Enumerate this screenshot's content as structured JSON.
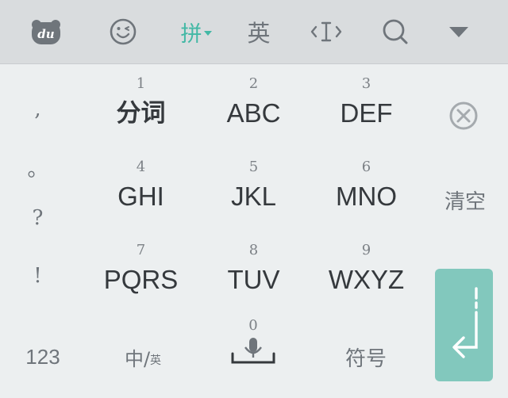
{
  "toolbar": {
    "logo_text": "du",
    "pinyin_label": "拼",
    "english_label": "英",
    "icons": [
      "baidu-logo-icon",
      "emoji-icon",
      "cursor-icon",
      "search-icon",
      "collapse-triangle-icon"
    ]
  },
  "punctuation": [
    ",",
    "。",
    "?",
    "!"
  ],
  "keys": [
    {
      "num": "1",
      "letters": "分词"
    },
    {
      "num": "2",
      "letters": "ABC"
    },
    {
      "num": "3",
      "letters": "DEF"
    },
    {
      "num": "4",
      "letters": "GHI"
    },
    {
      "num": "5",
      "letters": "JKL"
    },
    {
      "num": "6",
      "letters": "MNO"
    },
    {
      "num": "7",
      "letters": "PQRS"
    },
    {
      "num": "8",
      "letters": "TUV"
    },
    {
      "num": "9",
      "letters": "WXYZ"
    }
  ],
  "side": {
    "delete_icon": "delete-x-circle-icon",
    "clear_label": "清空"
  },
  "bottom": {
    "numbers_label": "123",
    "lang_main": "中/",
    "lang_sub": "英",
    "space_num": "0",
    "symbols_label": "符号",
    "enter_icon": "enter-return-icon"
  },
  "colors": {
    "accent": "#43b8a5",
    "enter_bg": "#82c8bd",
    "toolbar_bg": "#d9dcde",
    "keyboard_bg": "#eceff0"
  }
}
